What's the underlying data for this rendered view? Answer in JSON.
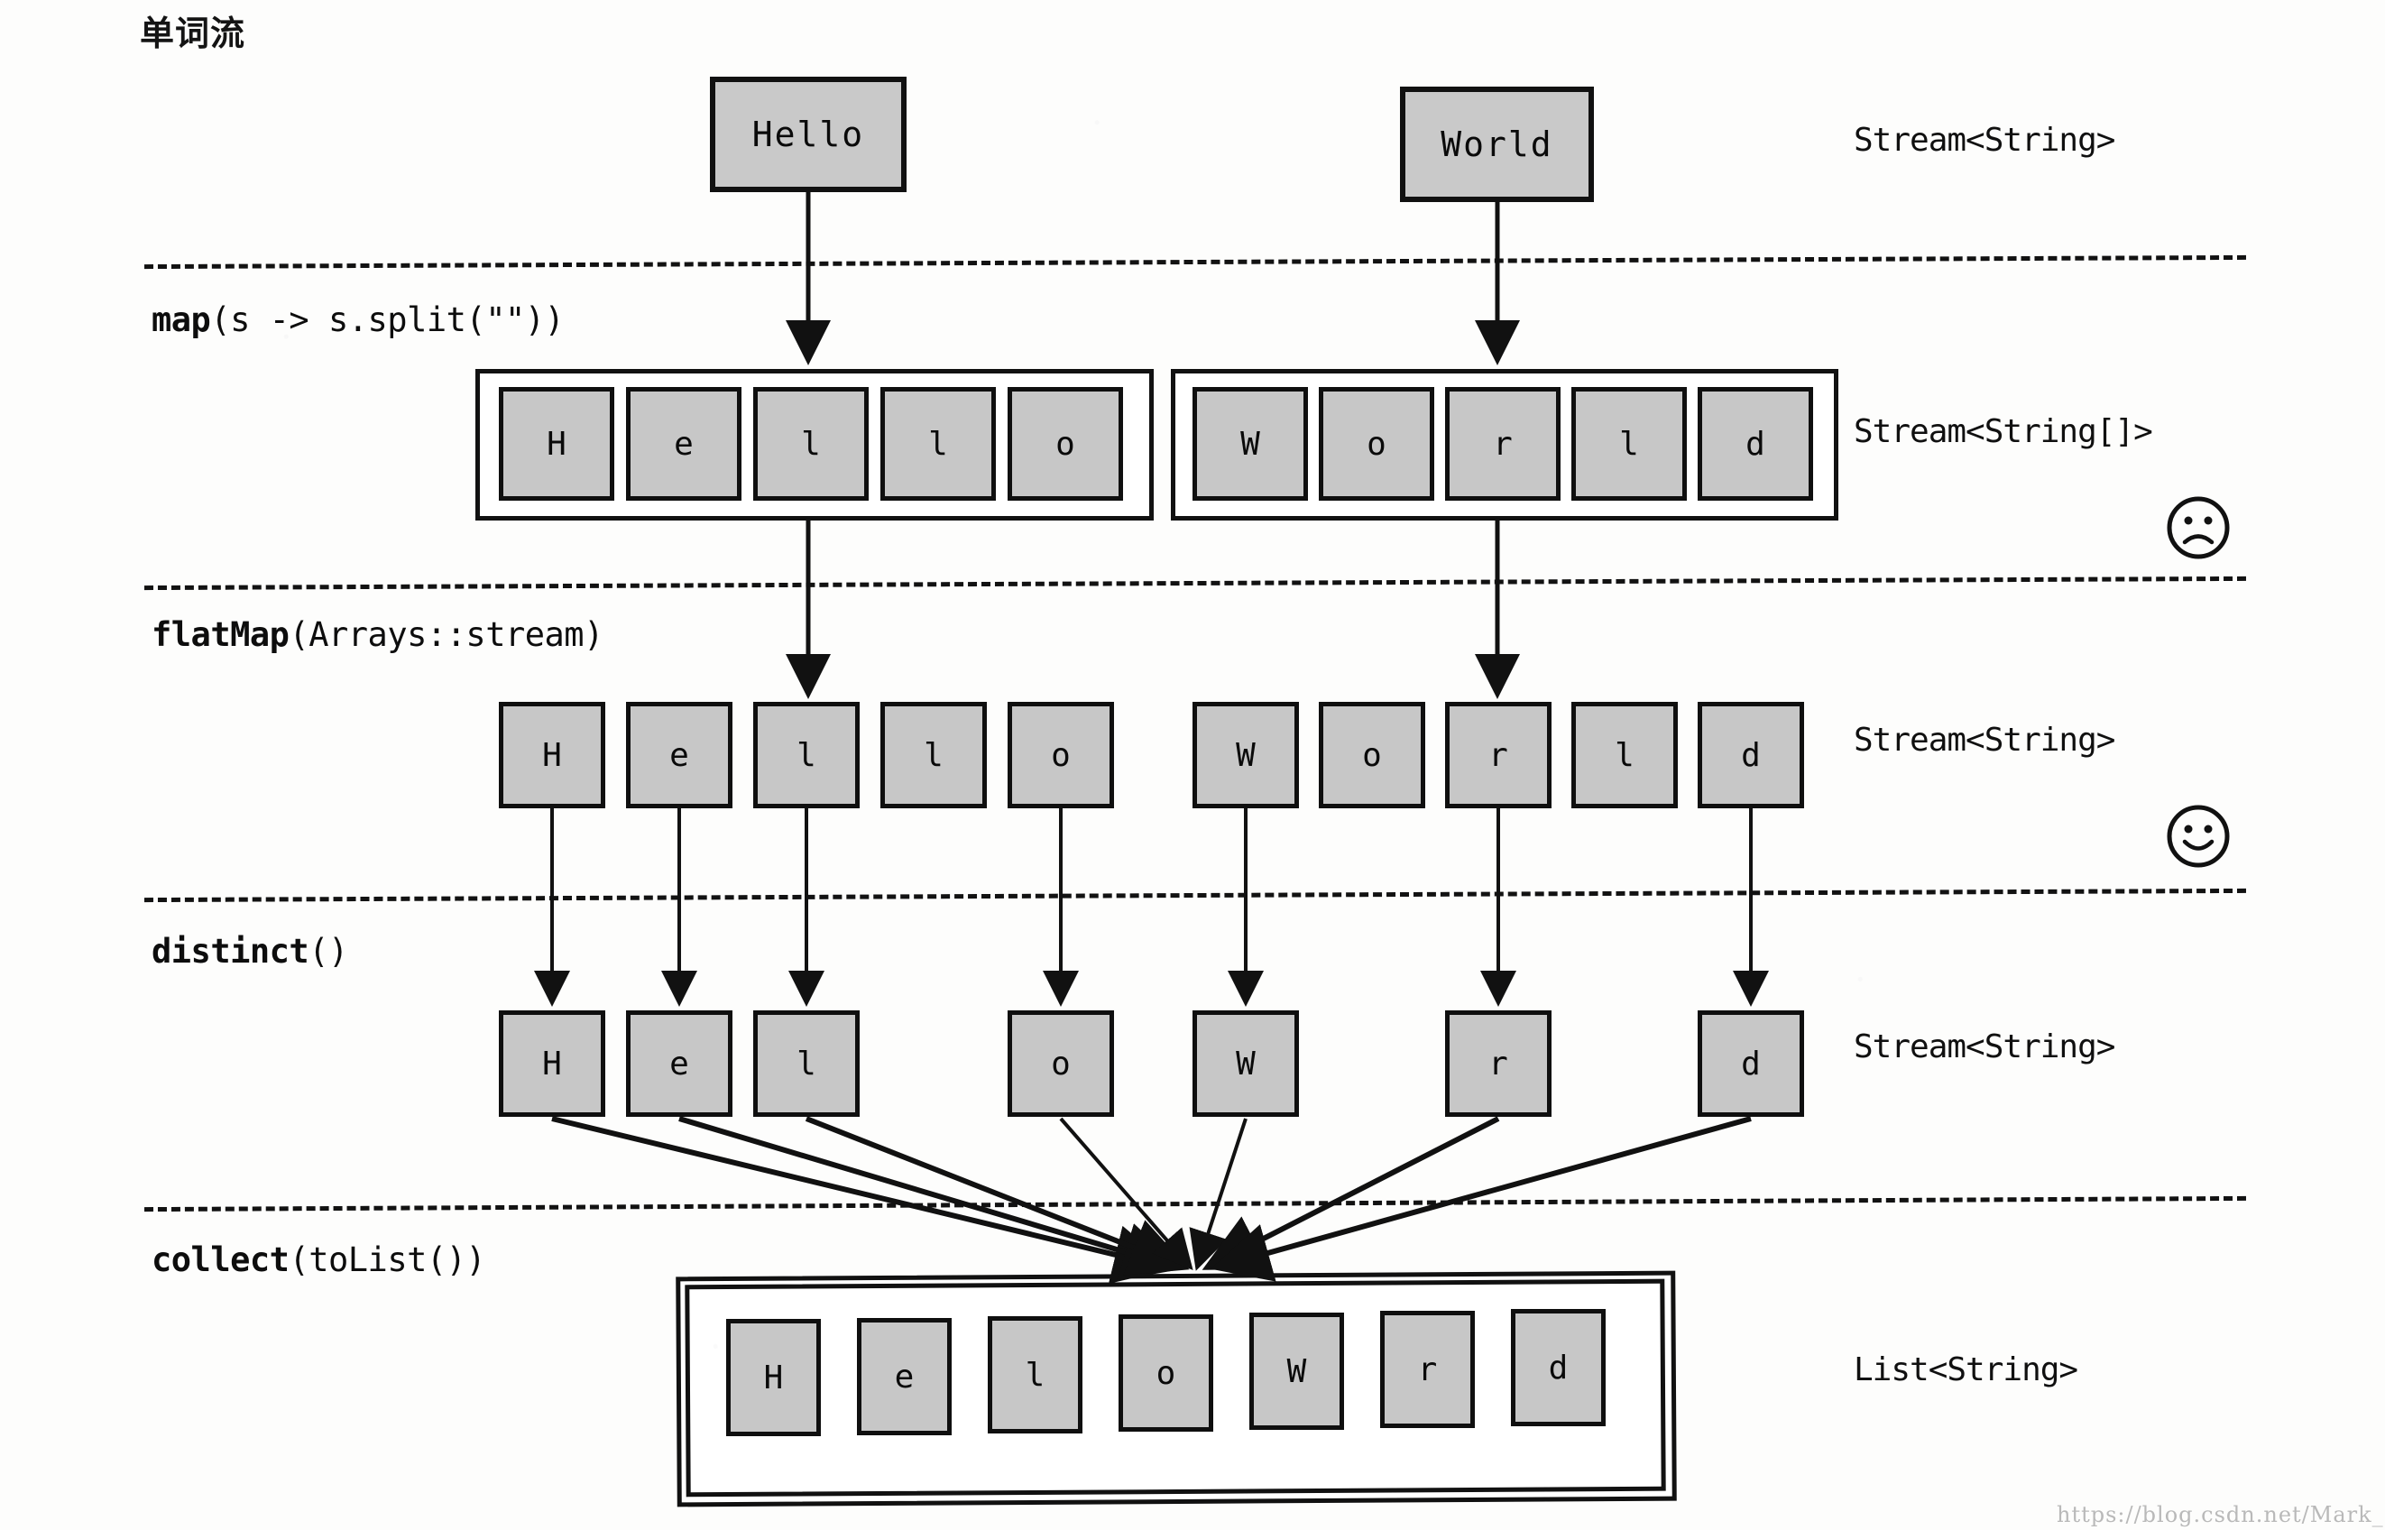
{
  "title": "单词流",
  "stages": [
    {
      "id": "map",
      "op": "map",
      "args": "(s -> s.split(\"\"))"
    },
    {
      "id": "flatMap",
      "op": "flatMap",
      "args": "(Arrays::stream)"
    },
    {
      "id": "distinct",
      "op": "distinct",
      "args": "()"
    },
    {
      "id": "collect",
      "op": "collect",
      "args": "(toList())"
    }
  ],
  "type_labels": [
    {
      "id": "t1",
      "text": "Stream<String>"
    },
    {
      "id": "t2",
      "text": "Stream<String[]>"
    },
    {
      "id": "t3",
      "text": "Stream<String>"
    },
    {
      "id": "t4",
      "text": "Stream<String>"
    },
    {
      "id": "t5",
      "text": "List<String>"
    }
  ],
  "faces": [
    {
      "id": "sad",
      "icon": "sad-face-icon",
      "glyph": "☹"
    },
    {
      "id": "happy",
      "icon": "happy-face-icon",
      "glyph": "☺"
    }
  ],
  "row_words": [
    {
      "label": "Hello"
    },
    {
      "label": "World"
    }
  ],
  "row_arrays": [
    {
      "label": "Hello",
      "letters": [
        "H",
        "e",
        "l",
        "l",
        "o"
      ]
    },
    {
      "label": "World",
      "letters": [
        "W",
        "o",
        "r",
        "l",
        "d"
      ]
    }
  ],
  "row_flatmap": {
    "letters": [
      "H",
      "e",
      "l",
      "l",
      "o",
      "W",
      "o",
      "r",
      "l",
      "d"
    ]
  },
  "row_distinct": {
    "letters": [
      "H",
      "e",
      "l",
      "o",
      "W",
      "r",
      "d"
    ]
  },
  "row_list": {
    "letters": [
      "H",
      "e",
      "l",
      "o",
      "W",
      "r",
      "d"
    ]
  },
  "watermark": "https://blog.csdn.net/Mark_Chao",
  "colors": {
    "ink": "#111111",
    "cell_fill": "#c7c7c7",
    "page": "#fdfdfc"
  },
  "chart_data": {
    "type": "diagram",
    "title": "单词流",
    "pipeline": [
      "map(s -> s.split(\"\"))",
      "flatMap(Arrays::stream)",
      "distinct()",
      "collect(toList())"
    ],
    "levels": [
      {
        "type": "Stream<String>",
        "content": [
          "Hello",
          "World"
        ]
      },
      {
        "type": "Stream<String[]>",
        "content": [
          [
            "H",
            "e",
            "l",
            "l",
            "o"
          ],
          [
            "W",
            "o",
            "r",
            "l",
            "d"
          ]
        ],
        "mood": "sad"
      },
      {
        "type": "Stream<String>",
        "content": [
          "H",
          "e",
          "l",
          "l",
          "o",
          "W",
          "o",
          "r",
          "l",
          "d"
        ],
        "mood": "happy"
      },
      {
        "type": "Stream<String>",
        "content": [
          "H",
          "e",
          "l",
          "o",
          "W",
          "r",
          "d"
        ]
      },
      {
        "type": "List<String>",
        "content": [
          "H",
          "e",
          "l",
          "o",
          "W",
          "r",
          "d"
        ]
      }
    ]
  }
}
